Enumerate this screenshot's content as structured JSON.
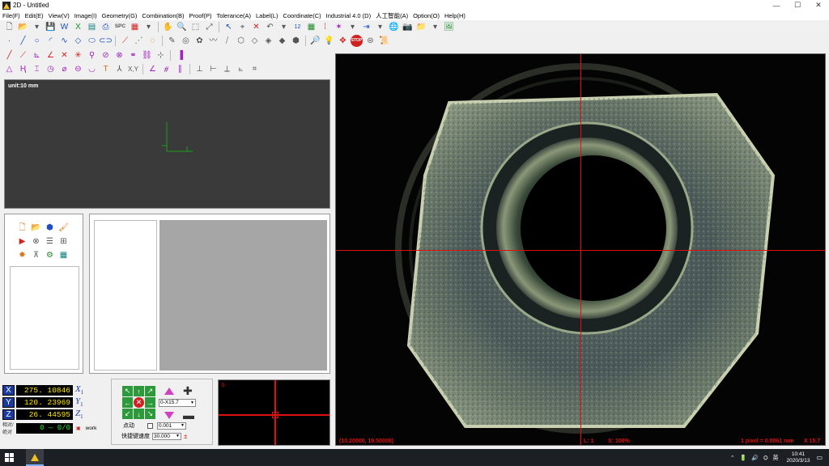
{
  "window": {
    "title": "2D - Untitled",
    "controls": [
      "—",
      "☐",
      "✕"
    ]
  },
  "menu": [
    "File(F)",
    "Edit(E)",
    "View(V)",
    "Image(I)",
    "Geometry(G)",
    "Combination(B)",
    "Proof(P)",
    "Tolerance(A)",
    "Label(L)",
    "Coordinate(C)",
    "Industrial 4.0 (D)",
    "人工智能(A)",
    "Option(O)",
    "Help(H)"
  ],
  "toolbar1": {
    "spc_label": "SPC",
    "stop_label": "STOP",
    "hole_label": "12"
  },
  "preview": {
    "unit_label": "unit:10 mm"
  },
  "coords": {
    "x_label": "X",
    "y_label": "Y",
    "z_label": "Z",
    "x_value": "275. 10846",
    "y_value": "120. 23969",
    "z_value": "26. 44595",
    "x_zero": "X",
    "y_zero": "Y",
    "z_zero": "Z",
    "sub": "1",
    "ab_label": "相对/绝对",
    "counter_value": "0 — 0/0",
    "work_label": "work"
  },
  "motion": {
    "zoom_value": "0-X15.7",
    "point_label": "点动",
    "step_value": "0.001",
    "speed_label": "快捷键速度",
    "speed_value": "30.000"
  },
  "mini_view": {
    "label": "S"
  },
  "camera": {
    "coords_readout": "(10.20000, 19.50000)",
    "light": "L: 1",
    "scale": "S: 100%",
    "pixel_size": "1 pixel = 0.0061 mm",
    "zoom": "X 15.7"
  },
  "taskbar": {
    "time": "10:41",
    "date": "2020/3/13"
  }
}
